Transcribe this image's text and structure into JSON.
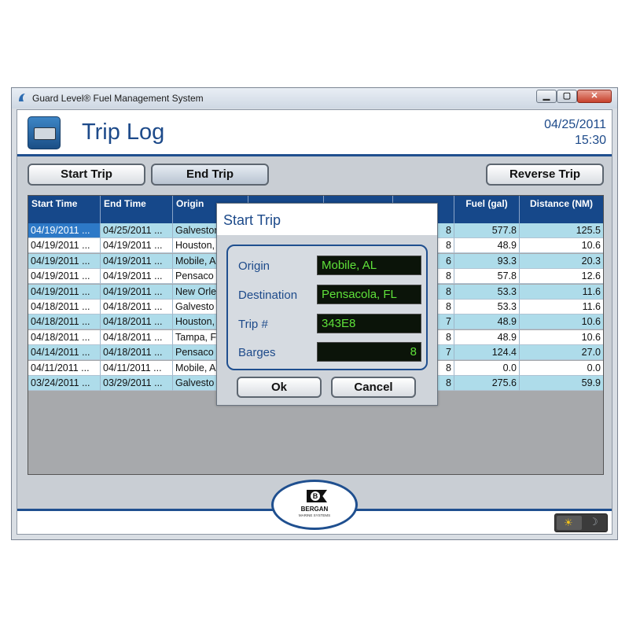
{
  "window": {
    "title": "Guard Level® Fuel Management System",
    "min_glyph": "▁",
    "max_glyph": "▢",
    "close_glyph": "✕"
  },
  "header": {
    "title": "Trip Log",
    "date": "04/25/2011",
    "time": "15:30"
  },
  "toolbar": {
    "start_trip": "Start Trip",
    "end_trip": "End Trip",
    "reverse_trip": "Reverse Trip"
  },
  "table": {
    "columns": [
      {
        "label": "Start Time"
      },
      {
        "label": "End Time"
      },
      {
        "label": "Origin"
      },
      {
        "label": ""
      },
      {
        "label": ""
      },
      {
        "label": ""
      },
      {
        "label": "Fuel (gal)"
      },
      {
        "label": "Distance (NM)"
      }
    ],
    "rows": [
      [
        "04/19/2011 ...",
        "04/25/2011 ...",
        "Galveston",
        "8",
        "577.8",
        "125.5"
      ],
      [
        "04/19/2011 ...",
        "04/19/2011 ...",
        "Houston,",
        "8",
        "48.9",
        "10.6"
      ],
      [
        "04/19/2011 ...",
        "04/19/2011 ...",
        "Mobile, A",
        "6",
        "93.3",
        "20.3"
      ],
      [
        "04/19/2011 ...",
        "04/19/2011 ...",
        "Pensaco",
        "8",
        "57.8",
        "12.6"
      ],
      [
        "04/19/2011 ...",
        "04/19/2011 ...",
        "New Orle",
        "8",
        "53.3",
        "11.6"
      ],
      [
        "04/18/2011 ...",
        "04/18/2011 ...",
        "Galvesto",
        "8",
        "53.3",
        "11.6"
      ],
      [
        "04/18/2011 ...",
        "04/18/2011 ...",
        "Houston,",
        "7",
        "48.9",
        "10.6"
      ],
      [
        "04/18/2011 ...",
        "04/18/2011 ...",
        "Tampa, F",
        "8",
        "48.9",
        "10.6"
      ],
      [
        "04/14/2011 ...",
        "04/18/2011 ...",
        "Pensaco",
        "7",
        "124.4",
        "27.0"
      ],
      [
        "04/11/2011 ...",
        "04/11/2011 ...",
        "Mobile, A",
        "8",
        "0.0",
        "0.0"
      ],
      [
        "03/24/2011 ...",
        "03/29/2011 ...",
        "Galvesto",
        "8",
        "275.6",
        "59.9"
      ]
    ]
  },
  "dialog": {
    "title": "Start Trip",
    "fields": [
      {
        "label": "Origin",
        "value": "Mobile, AL"
      },
      {
        "label": "Destination",
        "value": "Pensacola, FL"
      },
      {
        "label": "Trip #",
        "value": "343E8"
      },
      {
        "label": "Barges",
        "value": "8"
      }
    ],
    "ok": "Ok",
    "cancel": "Cancel"
  },
  "footer": {
    "brand_name": "BERGAN",
    "brand_sub": "MARINE SYSTEMS",
    "brand_initial": "B"
  },
  "colors": {
    "accent": "#1f4f8f",
    "header_blue": "#16488a",
    "row_alt": "#aedcea",
    "lcd_text": "#5fe23a"
  },
  "icons": {
    "app": "guard-level-icon",
    "sun": "☀",
    "moon": "☽"
  }
}
